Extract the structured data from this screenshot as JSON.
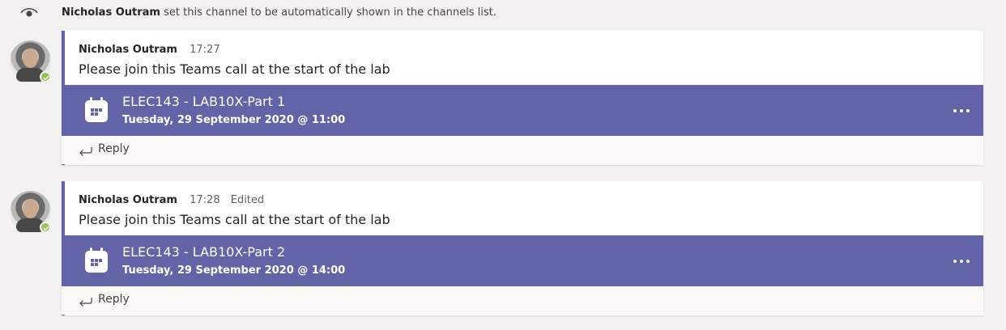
{
  "system_message": {
    "icon": "eye-icon",
    "actor": "Nicholas Outram",
    "text": "set this channel to be automatically shown in the channels list."
  },
  "posts": [
    {
      "author": "Nicholas Outram",
      "time": "17:27",
      "edited": "",
      "message": "Please join this Teams call at the start of the lab",
      "meeting": {
        "title": "ELEC143 - LAB10X-Part 1",
        "datetime": "Tuesday, 29 September 2020 @ 11:00"
      },
      "reply_label": "Reply"
    },
    {
      "author": "Nicholas Outram",
      "time": "17:28",
      "edited": "Edited",
      "message": "Please join this Teams call at the start of the lab",
      "meeting": {
        "title": "ELEC143 - LAB10X-Part 2",
        "datetime": "Tuesday, 29 September 2020 @ 14:00"
      },
      "reply_label": "Reply"
    }
  ],
  "colors": {
    "accent": "#6264a7",
    "presence": "#92c353",
    "background": "#f3f2f1"
  }
}
